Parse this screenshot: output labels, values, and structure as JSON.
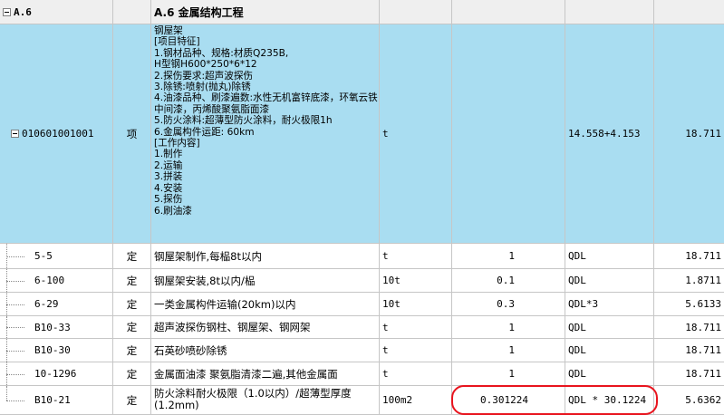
{
  "header": {
    "code": "A.6",
    "name": "A.6  金属结构工程"
  },
  "item": {
    "code": "010601001001",
    "type": "项",
    "desc_lines": [
      "钢屋架",
      "[项目特征]",
      "1.钢材品种、规格:材质Q235B,",
      "H型钢H600*250*6*12",
      "2.探伤要求:超声波探伤",
      "3.除锈:喷射(抛丸)除锈",
      "4.油漆品种、刷漆遍数:水性无机富锌底漆，环氧云铁中间漆，丙烯酸聚氨脂面漆",
      "5.防火涂料:超薄型防火涂料，耐火极限1h",
      "6.金属构件运距: 60km",
      "[工作内容]",
      "1.制作",
      "2.运输",
      "3.拼装",
      "4.安装",
      "5.探伤",
      "6.刷油漆"
    ],
    "unit": "t",
    "formula": "14.558+4.153",
    "quantity": "18.711"
  },
  "rows": [
    {
      "code": "5-5",
      "type": "定",
      "name": "钢屋架制作,每榀8t以内",
      "unit": "t",
      "coef": "1",
      "expr": "QDL",
      "qty": "18.711"
    },
    {
      "code": "6-100",
      "type": "定",
      "name": "钢屋架安装,8t以内/榀",
      "unit": "10t",
      "coef": "0.1",
      "expr": "QDL",
      "qty": "1.8711"
    },
    {
      "code": "6-29",
      "type": "定",
      "name": "一类金属构件运输(20km)以内",
      "unit": "10t",
      "coef": "0.3",
      "expr": "QDL*3",
      "qty": "5.6133"
    },
    {
      "code": "B10-33",
      "type": "定",
      "name": "超声波探伤钢柱、钢屋架、钢网架",
      "unit": "t",
      "coef": "1",
      "expr": "QDL",
      "qty": "18.711"
    },
    {
      "code": "B10-30",
      "type": "定",
      "name": "石英砂喷砂除锈",
      "unit": "t",
      "coef": "1",
      "expr": "QDL",
      "qty": "18.711"
    },
    {
      "code": "10-1296",
      "type": "定",
      "name": "金属面油漆 聚氨脂清漆二遍,其他金属面",
      "unit": "t",
      "coef": "1",
      "expr": "QDL",
      "qty": "18.711"
    },
    {
      "code": "B10-21",
      "type": "定",
      "name": "防火涂料耐火极限（1.0以内）/超薄型厚度(1.2mm)",
      "unit": "100m2",
      "coef": "0.301224",
      "expr": "QDL * 30.1224",
      "qty": "5.6362"
    }
  ],
  "colors": {
    "selected_row": "#a9ddf1",
    "annotation": "#e8141e",
    "grid": "#c6c6c6"
  }
}
